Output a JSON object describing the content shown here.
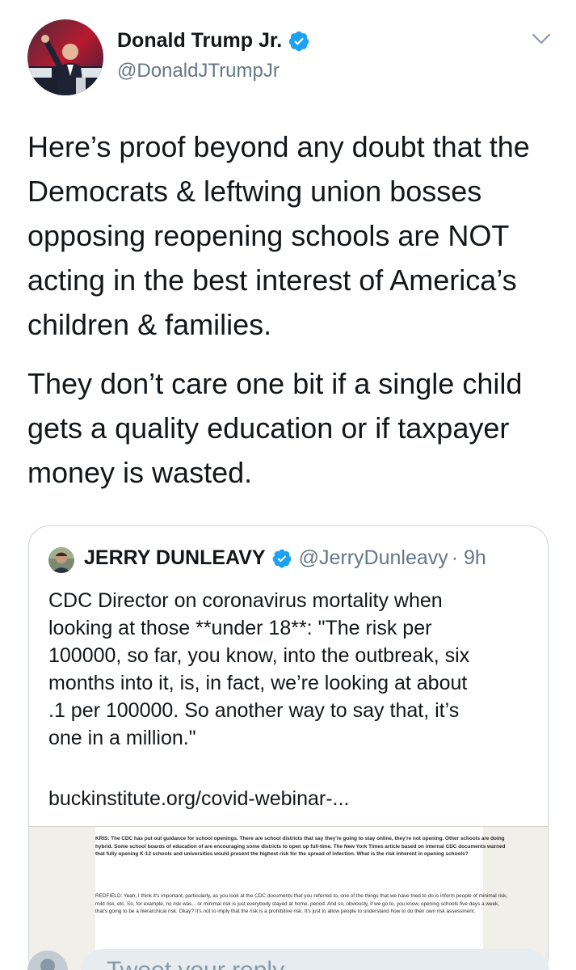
{
  "author": {
    "name": "Donald Trump Jr.",
    "handle": "@DonaldJTrumpJr",
    "verified": true,
    "avatar_icon": "profile-photo"
  },
  "tweet": {
    "paragraphs": [
      "Here’s proof beyond any doubt that the Democrats & leftwing union bosses opposing reopening schools are NOT acting in the best interest of America’s children & families.",
      "They don’t care one bit if a single child gets a quality education or if taxpayer money is wasted."
    ]
  },
  "quoted": {
    "name": "JERRY DUNLEAVY",
    "handle": "@JerryDunleavy",
    "time": "· 9h",
    "text": "CDC Director on coronavirus mortality when\nlooking at those **under 18**: \"The risk per\n100000, so far, you know, into the outbreak, six\nmonths into it, is, in fact, we’re looking at about\n.1 per 100000. So another way to say that, it’s\none in a million.\"",
    "link": "buckinstitute.org/covid-webinar-...",
    "preview": {
      "kris": "KRIS: The CDC has put out guidance for school openings. There are school districts that say they're going to stay online, they're not opening. Other schools are doing hybrid. Some school boards of education of are encouraging some districts to open up full-time. The New York Times article based on internal CDC documents warned that fully opening K-12 schools and universities would present the highest risk for the spread of infection. What is the risk inherent in opening schools?",
      "redfield": "REDFIELD: Yeah, I think it's important, particularly, as you look at the CDC documents that you referred to, one of the things that we have tried to do is inform people of minimal risk, mild risk, etc. So, for example, no risk was... or minimal risk is just everybody stayed at home, period. And so, obviously, if we go to, you know, opening schools five days a week, that's going to be a hierarchical risk. Okay? It's not to imply that the risk is a prohibitive risk. It's just to allow people to understand how to do their own risk assessment."
    }
  },
  "reply": {
    "placeholder": "Tweet your reply"
  },
  "colors": {
    "verified_blue": "#1da1f2",
    "text_primary": "#14171a",
    "text_secondary": "#657786",
    "border": "#ccd6dd"
  }
}
